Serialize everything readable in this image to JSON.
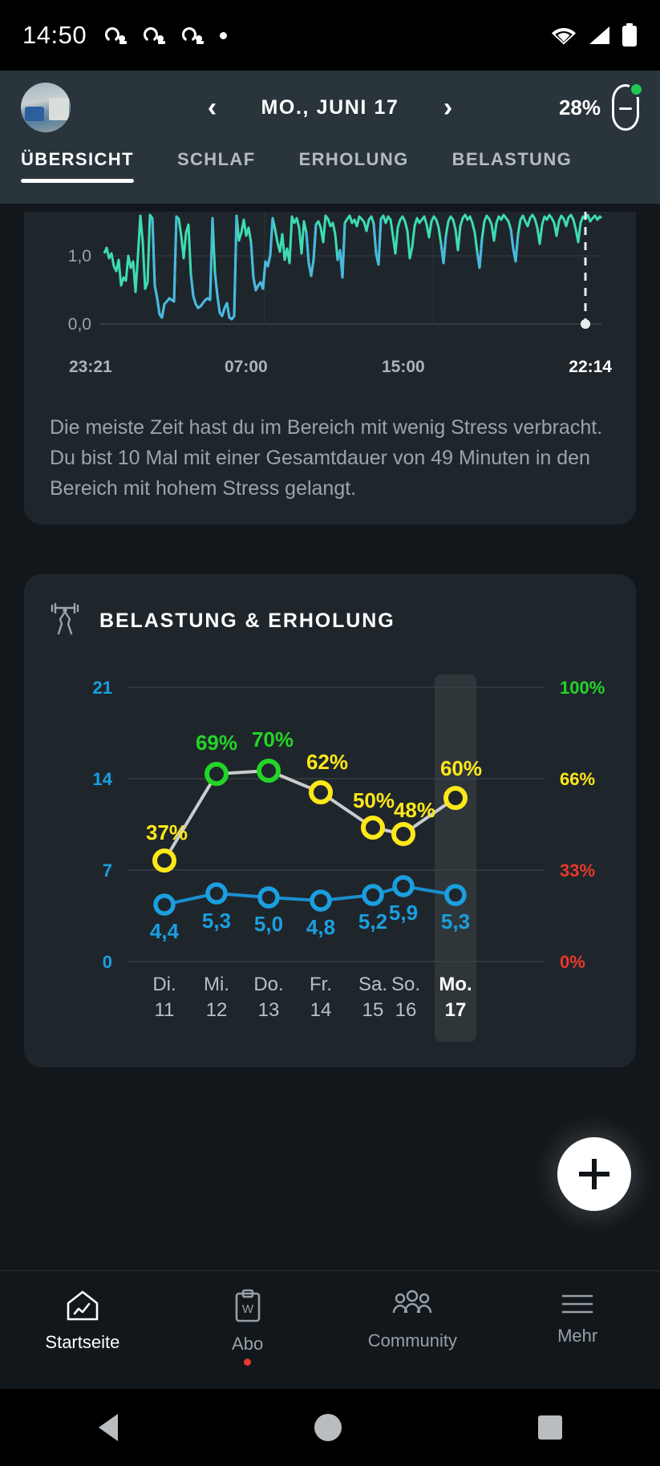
{
  "status_bar": {
    "time": "14:50",
    "notification_icons": [
      "discord-icon",
      "discord-icon",
      "discord-icon"
    ],
    "dot": "•",
    "right_icons": [
      "wifi-icon",
      "signal-icon",
      "battery-icon"
    ]
  },
  "header": {
    "avatar": "user-avatar",
    "prev_label": "‹",
    "next_label": "›",
    "date": "MO., JUNI 17",
    "battery_percent": "28%",
    "device_icon": "watch-icon",
    "device_status_color": "#21c954"
  },
  "tabs": [
    {
      "label": "ÜBERSICHT",
      "active": true
    },
    {
      "label": "SCHLAF",
      "active": false
    },
    {
      "label": "ERHOLUNG",
      "active": false
    },
    {
      "label": "BELASTUNG",
      "active": false
    }
  ],
  "stress_card": {
    "y_labels": [
      "1,0",
      "0,0"
    ],
    "x_labels": [
      "23:21",
      "07:00",
      "15:00",
      "22:14"
    ],
    "description": "Die meiste Zeit hast du im Bereich mit wenig Stress verbracht. Du bist 10 Mal mit einer Gesamtdauer von 49 Minuten in den Bereich mit hohem Stress gelangt."
  },
  "load_card": {
    "icon": "weightlifter-icon",
    "title": "BELASTUNG & ERHOLUNG"
  },
  "fab": {
    "icon": "plus-icon",
    "label": "+"
  },
  "bottom_nav": [
    {
      "label": "Startseite",
      "icon": "home-chart-icon",
      "active": true,
      "badge": false
    },
    {
      "label": "Abo",
      "icon": "clipboard-w-icon",
      "active": false,
      "badge": true
    },
    {
      "label": "Community",
      "icon": "people-icon",
      "active": false,
      "badge": false
    },
    {
      "label": "Mehr",
      "icon": "hamburger-icon",
      "active": false,
      "badge": false
    }
  ],
  "android_nav": [
    "back-icon",
    "home-icon",
    "recents-icon"
  ],
  "chart_data": [
    {
      "type": "line",
      "title": "Stress",
      "xlabel": "",
      "ylabel": "",
      "ylim": [
        0.0,
        1.6
      ],
      "ytick_labels": [
        "1,0",
        "0,0"
      ],
      "xtick_labels": [
        "23:21",
        "07:00",
        "15:00",
        "22:14"
      ],
      "grid": true,
      "legend": "none",
      "colors": {
        "high": "#3de0b0",
        "low": "#4ab7e0"
      },
      "note": "dense intraday stress trace, teal for elevated values, blue for low values",
      "values": [
        1.02,
        0.98,
        1.06,
        1.0,
        0.9,
        0.86,
        0.95,
        0.7,
        0.78,
        0.74,
        0.96,
        0.84,
        0.9,
        0.62,
        1.0,
        1.48,
        1.1,
        0.65,
        0.72,
        1.5,
        1.45,
        0.7,
        0.55,
        0.3,
        0.22,
        0.42,
        0.45,
        0.5,
        0.48,
        0.46,
        1.5,
        1.45,
        1.2,
        0.95,
        1.25,
        1.35,
        0.8,
        0.55,
        0.45,
        0.4,
        0.42,
        0.46,
        0.5,
        0.52,
        0.5,
        1.45,
        0.8,
        0.55,
        0.3,
        0.25,
        0.35,
        0.4,
        0.22,
        0.2,
        0.24,
        1.5,
        1.1,
        1.25,
        1.4,
        1.2,
        1.3,
        1.1,
        0.75,
        0.6,
        0.68,
        0.72,
        0.62,
        0.9,
        0.85,
        1.0,
        1.45,
        1.3,
        1.1,
        0.95,
        1.2,
        0.9,
        1.05,
        0.85,
        1.5,
        1.4,
        1.45,
        1.3,
        1.0,
        1.4,
        1.25,
        0.85,
        0.7,
        0.9,
        1.35,
        1.4,
        1.3,
        1.1,
        1.5,
        1.45,
        1.35,
        1.4,
        1.2,
        0.9,
        1.05,
        0.7,
        1.4,
        1.45,
        1.5,
        1.4,
        1.45,
        1.35,
        1.5,
        1.45,
        1.4,
        1.3,
        1.45,
        1.5,
        1.4,
        1.0,
        0.85,
        1.45,
        1.5,
        1.4,
        1.5,
        1.45
      ]
    },
    {
      "type": "line",
      "title": "BELASTUNG & ERHOLUNG",
      "categories": [
        "Di.",
        "Mi.",
        "Do.",
        "Fr.",
        "Sa.",
        "So.",
        "Mo."
      ],
      "category_dates": [
        "11",
        "12",
        "13",
        "14",
        "15",
        "16",
        "17"
      ],
      "selected_category_index": 6,
      "left_axis": {
        "ticks": [
          "21",
          "14",
          "7",
          "0"
        ],
        "values": [
          21,
          14,
          7,
          0
        ],
        "color": "#1a9fe0"
      },
      "right_axis": {
        "ticks": [
          "100%",
          "66%",
          "33%",
          "0%"
        ],
        "values": [
          100,
          66,
          33,
          0
        ],
        "colors": [
          "#22d527",
          "#ffe81a",
          "#e8392b",
          "#e8392b"
        ]
      },
      "grid": true,
      "legend": "none",
      "series": [
        {
          "name": "Erholung",
          "unit": "%",
          "axis": "right",
          "labels": [
            "37%",
            "69%",
            "70%",
            "62%",
            "50%",
            "48%",
            "60%"
          ],
          "values": [
            37,
            69,
            70,
            62,
            50,
            48,
            60
          ],
          "point_colors": [
            "#ffe81a",
            "#22d527",
            "#22d527",
            "#ffe81a",
            "#ffe81a",
            "#ffe81a",
            "#ffe81a"
          ],
          "line_color": "#c8ccce"
        },
        {
          "name": "Belastung",
          "unit": "",
          "axis": "left",
          "labels": [
            "4,4",
            "5,3",
            "5,0",
            "4,8",
            "5,2",
            "5,9",
            "5,3"
          ],
          "values": [
            4.4,
            5.3,
            5.0,
            4.8,
            5.2,
            5.9,
            5.3
          ],
          "point_colors": [
            "#1a9fe0",
            "#1a9fe0",
            "#1a9fe0",
            "#1a9fe0",
            "#1a9fe0",
            "#1a9fe0",
            "#1a9fe0"
          ],
          "line_color": "#1a8fd0"
        }
      ]
    }
  ]
}
